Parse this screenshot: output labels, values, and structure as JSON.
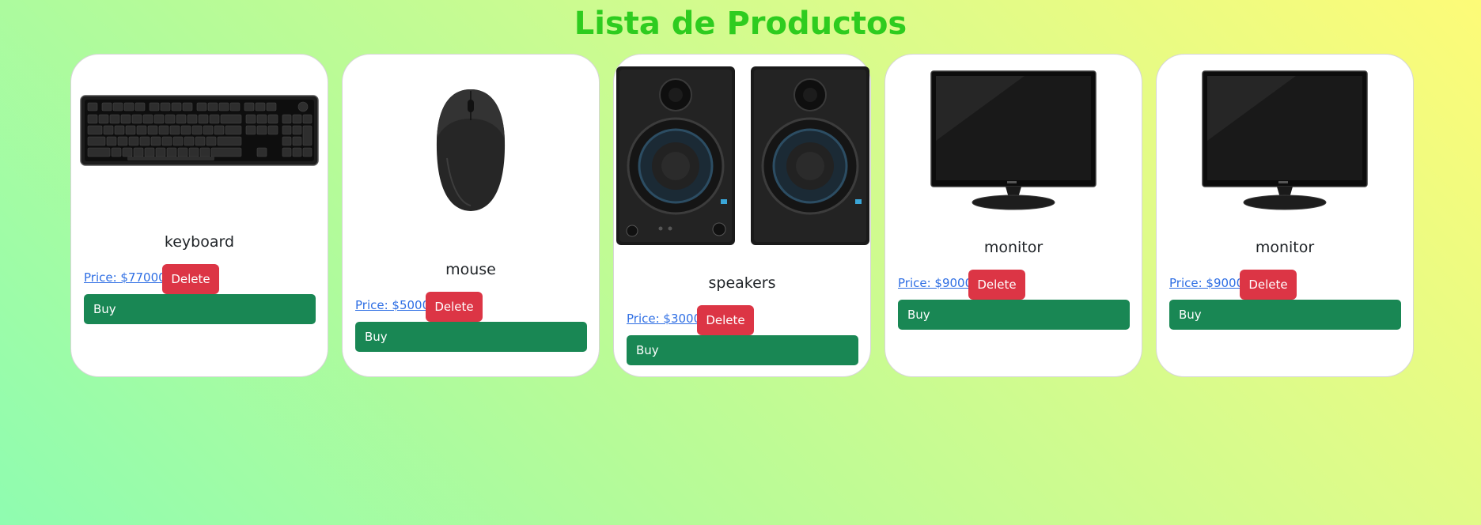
{
  "page": {
    "title": "Lista de Productos"
  },
  "products": [
    {
      "name": "keyboard",
      "price_label": "Price: $77000",
      "delete_label": "Delete",
      "buy_label": "Buy",
      "image_icon": "keyboard-icon"
    },
    {
      "name": "mouse",
      "price_label": "Price: $5000",
      "delete_label": "Delete",
      "buy_label": "Buy",
      "image_icon": "mouse-icon"
    },
    {
      "name": "speakers",
      "price_label": "Price: $3000",
      "delete_label": "Delete",
      "buy_label": "Buy",
      "image_icon": "speakers-icon"
    },
    {
      "name": "monitor",
      "price_label": "Price: $9000",
      "delete_label": "Delete",
      "buy_label": "Buy",
      "image_icon": "monitor-icon"
    },
    {
      "name": "monitor",
      "price_label": "Price: $9000",
      "delete_label": "Delete",
      "buy_label": "Buy",
      "image_icon": "monitor-icon"
    }
  ],
  "colors": {
    "title": "#2ecc1f",
    "delete_button": "#dc3545",
    "buy_button": "#198754",
    "price_link": "#2f6fe4"
  }
}
